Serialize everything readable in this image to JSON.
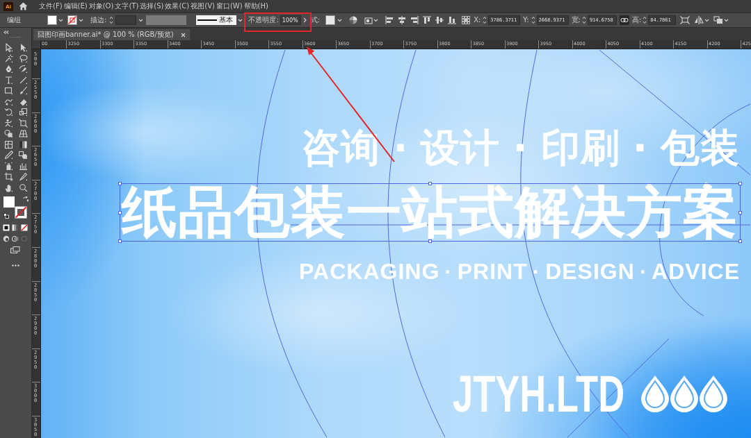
{
  "app": {
    "logo": "Ai"
  },
  "menu_bar": {
    "items": [
      "文件(F)",
      "编辑(E)",
      "对象(O)",
      "文字(T)",
      "选择(S)",
      "效果(C)",
      "视图(V)",
      "窗口(W)",
      "帮助(H)"
    ]
  },
  "control_bar": {
    "selection": "编组",
    "stroke_label": "描边:",
    "brush": "基本",
    "opacity_label": "不透明度:",
    "opacity_value": "100%",
    "style_label": "式:",
    "x_label": "X:",
    "x_value": "3786.3711",
    "y_label": "Y:",
    "y_value": "2668.9371",
    "width_label": "宽:",
    "width_value": "914.6758",
    "constrain_proportions": true,
    "height_label": "高:",
    "height_value": "84.7861"
  },
  "document_tab": {
    "title": "囧图印画banner.ai* @ 100 % (RGB/预览)"
  },
  "rulers": {
    "horizontal": [
      "00",
      "3250",
      "3300",
      "3350",
      "3400",
      "3450",
      "3500",
      "3550",
      "3600",
      "3650",
      "3700",
      "3750",
      "3800",
      "3850",
      "3900",
      "3950",
      "4000",
      "4050",
      "4100",
      "4150",
      "4200",
      "425"
    ],
    "vertical": [
      "500",
      "2550",
      "2600",
      "2650",
      "2700",
      "2750",
      "2800",
      "2850",
      "2900",
      "2950",
      "3000",
      "3050"
    ]
  },
  "artboard": {
    "objects": [
      {
        "kind": "tagline",
        "text": "咨询 · 设计 · 印刷 · 包装",
        "selected": false
      },
      {
        "kind": "title",
        "text": "纸品包装一站式解决方案",
        "selected": true
      },
      {
        "kind": "subtitle",
        "text": "PACKAGING · PRINT · DESIGN · ADVICE",
        "selected": false
      },
      {
        "kind": "logo",
        "text": "JTYH.LTD",
        "selected": false
      }
    ]
  }
}
